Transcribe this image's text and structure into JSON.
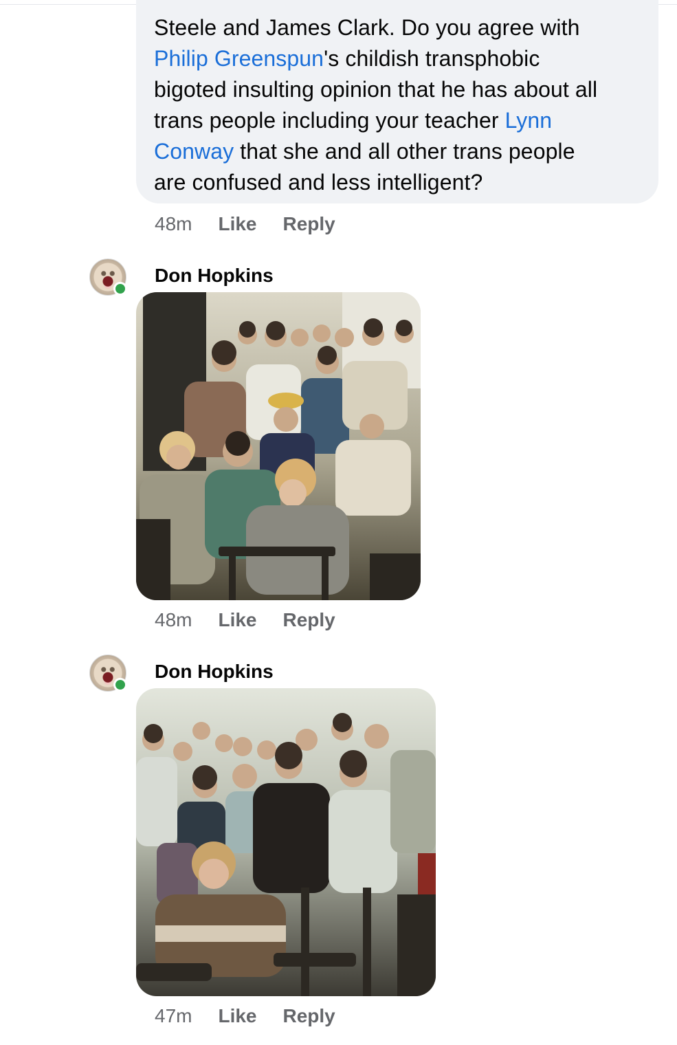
{
  "comment_1": {
    "text_lines": [
      [
        {
          "t": "Steele and James Clark. Do you agree with"
        }
      ],
      [
        {
          "t": "Philip Greenspun",
          "m": true
        },
        {
          "t": "'s childish transphobic"
        }
      ],
      [
        {
          "t": "bigoted insulting opinion that he has about all"
        }
      ],
      [
        {
          "t": "trans people including your teacher "
        },
        {
          "t": "Lynn",
          "m": true
        }
      ],
      [
        {
          "t": "Conway",
          "m": true
        },
        {
          "t": " that she and all other trans people"
        }
      ],
      [
        {
          "t": "are confused and less intelligent?"
        }
      ]
    ],
    "time": "48m",
    "like_label": "Like",
    "reply_label": "Reply"
  },
  "comment_2": {
    "author": "Don Hopkins",
    "photo_icon": "group-photo",
    "time": "48m",
    "like_label": "Like",
    "reply_label": "Reply"
  },
  "comment_3": {
    "author": "Don Hopkins",
    "photo_icon": "group-photo",
    "time": "47m",
    "like_label": "Like",
    "reply_label": "Reply"
  },
  "colors": {
    "mention": "#1a6ed8",
    "bubble": "#f0f2f5",
    "meta": "#65676b",
    "online": "#31a24c"
  }
}
